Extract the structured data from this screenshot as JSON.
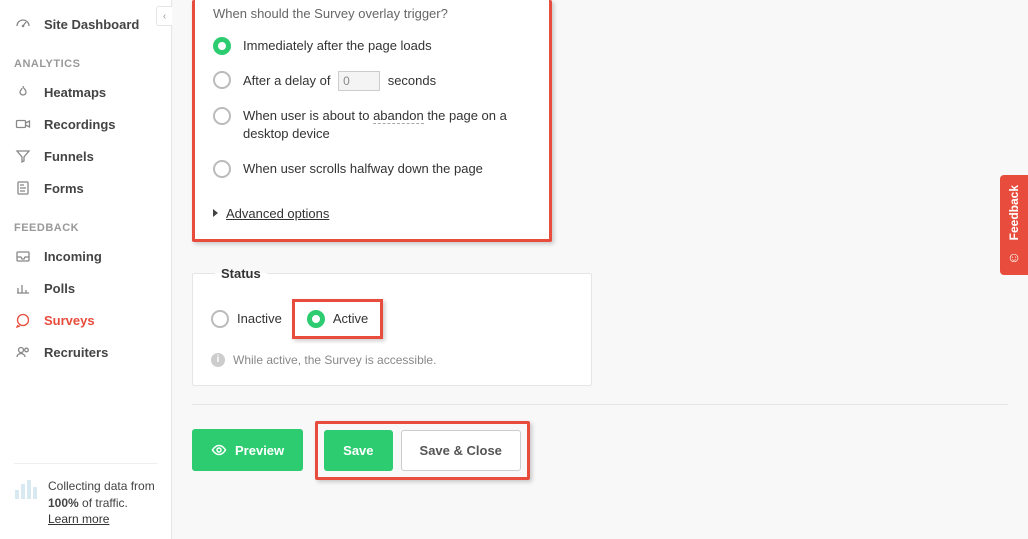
{
  "sidebar": {
    "dashboard_label": "Site Dashboard",
    "section_analytics": "ANALYTICS",
    "section_feedback": "FEEDBACK",
    "items": [
      {
        "label": "Heatmaps"
      },
      {
        "label": "Recordings"
      },
      {
        "label": "Funnels"
      },
      {
        "label": "Forms"
      },
      {
        "label": "Incoming"
      },
      {
        "label": "Polls"
      },
      {
        "label": "Surveys"
      },
      {
        "label": "Recruiters"
      }
    ],
    "collecting_prefix": "Collecting data from ",
    "collecting_bold": "100%",
    "collecting_suffix": " of traffic.",
    "learn_more": "Learn more"
  },
  "survey": {
    "trigger_question": "When should the Survey overlay trigger?",
    "options": {
      "immediate": "Immediately after the page loads",
      "delay_prefix": "After a delay of",
      "delay_value": "0",
      "delay_suffix": "seconds",
      "abandon_prefix": "When user is about to ",
      "abandon_word": "abandon",
      "abandon_suffix": " the page on a desktop device",
      "scroll": "When user scrolls halfway down the page"
    },
    "advanced": "Advanced options"
  },
  "status": {
    "legend": "Status",
    "inactive": "Inactive",
    "active": "Active",
    "hint": "While active, the Survey is accessible."
  },
  "actions": {
    "preview": "Preview",
    "save": "Save",
    "save_close": "Save & Close"
  },
  "feedback_tab": "Feedback"
}
